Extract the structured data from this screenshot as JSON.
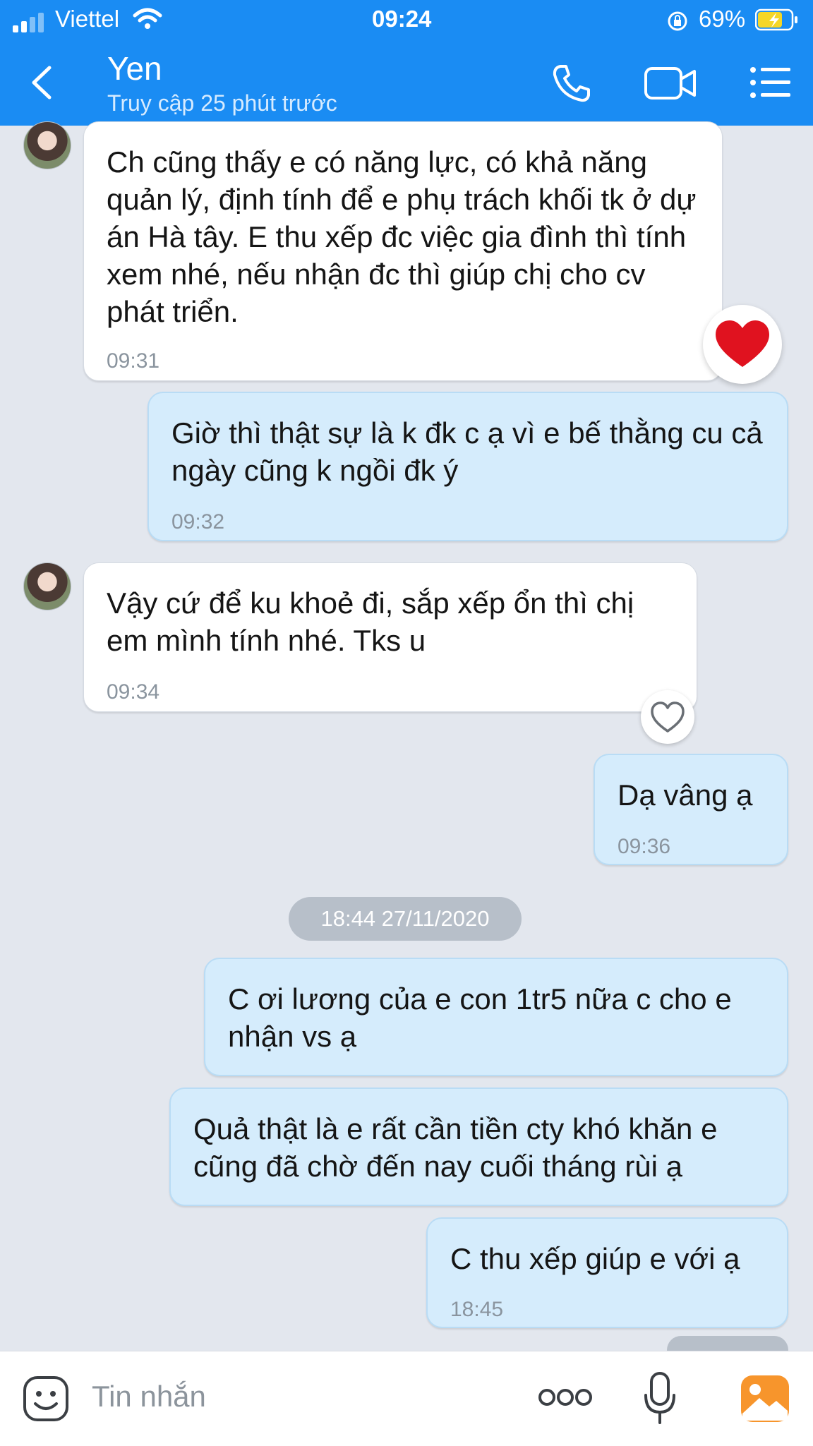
{
  "status_bar": {
    "carrier": "Viettel",
    "time": "09:24",
    "battery": "69%"
  },
  "header": {
    "contact_name": "Yen",
    "last_seen": "Truy cập 25 phút trước"
  },
  "messages": [
    {
      "direction": "in",
      "text": "Ch cũng thấy e có năng lực, có khả năng quản lý, định tính để e phụ trách khối tk ở dự án Hà tây. E thu xếp đc việc gia đình thì tính xem nhé, nếu nhận đc thì giúp chị cho cv phát triển.",
      "time": "09:31",
      "reaction": "heart-filled"
    },
    {
      "direction": "out",
      "text": "Giờ thì thật sự là k đk c ạ vì e bế thằng cu cả ngày cũng k ngồi đk ý",
      "time": "09:32"
    },
    {
      "direction": "in",
      "text": "Vậy cứ để ku khoẻ đi, sắp xếp ổn thì chị em mình tính nhé. Tks u",
      "time": "09:34",
      "reaction": "heart-outline"
    },
    {
      "direction": "out",
      "text": "Dạ vâng ạ",
      "time": "09:36"
    },
    {
      "direction": "out",
      "text": "C ơi lương của e con 1tr5 nữa c cho e nhận vs ạ",
      "time": ""
    },
    {
      "direction": "out",
      "text": "Quả thật là e rất cần tiền cty khó khăn e cũng đã chờ đến nay cuối tháng rùi ạ",
      "time": ""
    },
    {
      "direction": "out",
      "text": "C thu xếp giúp e với ạ",
      "time": "18:45"
    }
  ],
  "date_separator": "18:44 27/11/2020",
  "input": {
    "placeholder": "Tin nhắn"
  },
  "colors": {
    "header": "#1a8cf3",
    "chat_bg": "#e3e7ee",
    "outgoing_bubble": "#d5ecfc",
    "incoming_bubble": "#ffffff",
    "heart": "#e0121f"
  }
}
